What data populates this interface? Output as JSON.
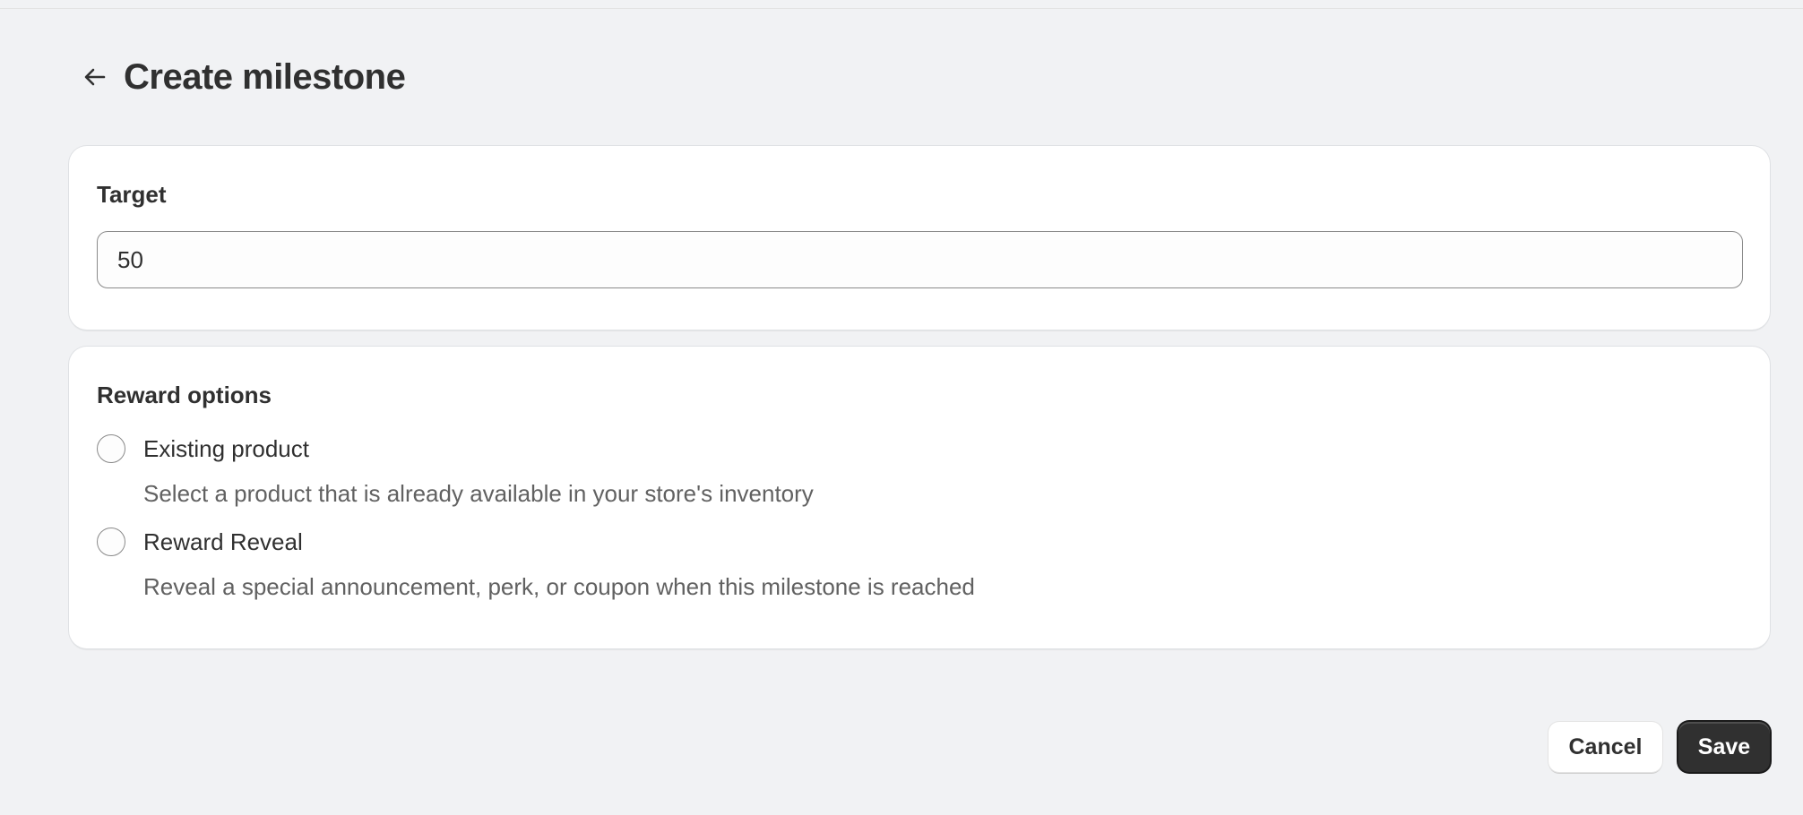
{
  "page": {
    "title": "Create milestone"
  },
  "target_card": {
    "title": "Target",
    "input_value": "50"
  },
  "reward_card": {
    "title": "Reward options",
    "options": [
      {
        "label": "Existing product",
        "help": "Select a product that is already available in your store's inventory",
        "selected": false
      },
      {
        "label": "Reward Reveal",
        "help": "Reveal a special announcement, perk, or coupon when this milestone is reached",
        "selected": false
      }
    ]
  },
  "footer": {
    "cancel_label": "Cancel",
    "save_label": "Save"
  },
  "colors": {
    "background": "#f1f2f4",
    "card": "#ffffff",
    "text": "#303030",
    "muted_text": "#616161",
    "primary_button": "#303030"
  },
  "icons": {
    "back": "arrow-left-icon"
  }
}
